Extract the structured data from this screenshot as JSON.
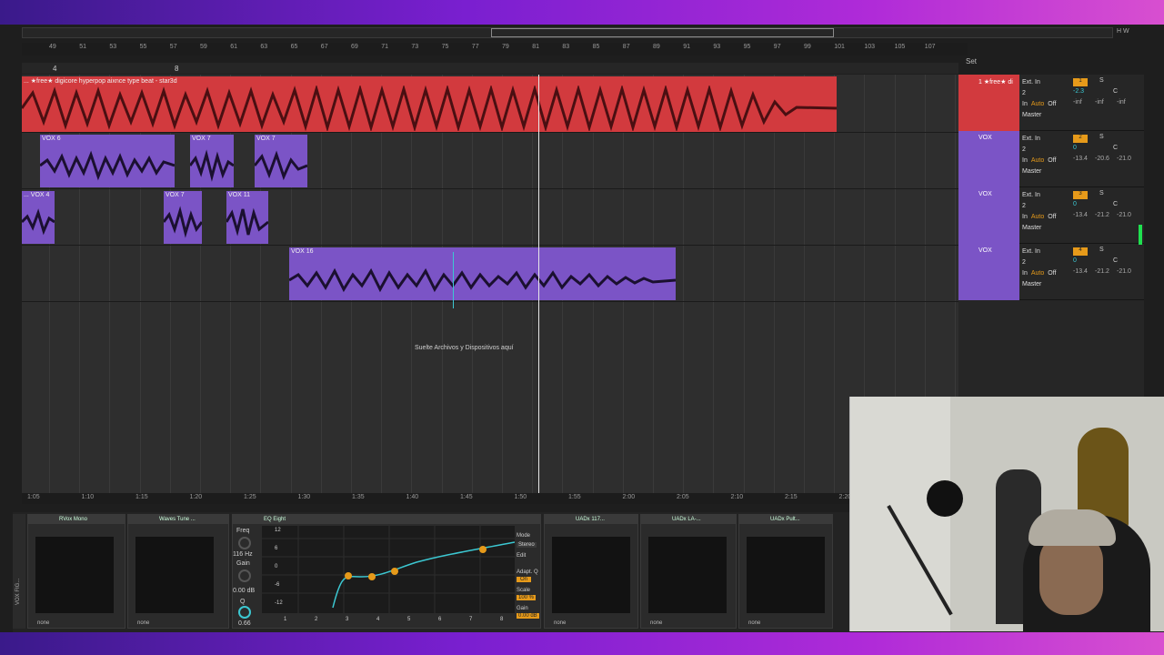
{
  "colors": {
    "audio_track": "#d23a3e",
    "vox_track": "#7b54c6",
    "accent": "#e69a1a",
    "eq_curve": "#3cc8d2"
  },
  "ruler_top": [
    "49",
    "51",
    "53",
    "55",
    "57",
    "59",
    "61",
    "63",
    "65",
    "67",
    "69",
    "71",
    "73",
    "75",
    "77",
    "79",
    "81",
    "83",
    "85",
    "87",
    "89",
    "91",
    "93",
    "95",
    "97",
    "99",
    "101",
    "103",
    "105",
    "107"
  ],
  "ruler_bottom": [
    "1:05",
    "1:10",
    "1:15",
    "1:20",
    "1:25",
    "1:30",
    "1:35",
    "1:40",
    "1:45",
    "1:50",
    "1:55",
    "2:00",
    "2:05",
    "2:10",
    "2:15",
    "2:20"
  ],
  "set_label": "Set",
  "loop_markers": [
    "4",
    "8"
  ],
  "tracks": [
    {
      "clips": [
        {
          "name": "... ★free★ digicore hyperpop aixnce type beat - star3d"
        }
      ]
    },
    {
      "clips": [
        {
          "name": "VOX 6"
        },
        {
          "name": "VOX 7"
        },
        {
          "name": "VOX 7"
        }
      ]
    },
    {
      "clips": [
        {
          "name": "... VOX 4"
        },
        {
          "name": "VOX 7"
        },
        {
          "name": "VOX 11"
        }
      ]
    },
    {
      "clips": [
        {
          "name": "VOX 16"
        }
      ]
    }
  ],
  "drop_text": "Suelte Archivos y Dispositivos aquí",
  "mixer": [
    {
      "name": "1 ★free★ di",
      "input": "Ext. In",
      "channel": "2",
      "monitor_in": "In",
      "monitor_auto": "Auto",
      "monitor_off": "Off",
      "output": "Master",
      "number": "1",
      "vol": "-2.3",
      "pan": "C",
      "peak1": "-inf",
      "peak2": "-inf",
      "peak3": "-inf",
      "solo": "S"
    },
    {
      "name": "VOX",
      "input": "Ext. In",
      "channel": "2",
      "monitor_in": "In",
      "monitor_auto": "Auto",
      "monitor_off": "Off",
      "output": "Master",
      "number": "2",
      "vol": "0",
      "pan": "C",
      "peak1": "-13.4",
      "peak2": "-20.6",
      "peak3": "-21.0",
      "solo": "S"
    },
    {
      "name": "VOX",
      "input": "Ext. In",
      "channel": "2",
      "monitor_in": "In",
      "monitor_auto": "Auto",
      "monitor_off": "Off",
      "output": "Master",
      "number": "3",
      "vol": "0",
      "pan": "C",
      "peak1": "-13.4",
      "peak2": "-21.2",
      "peak3": "-21.0",
      "solo": "S"
    },
    {
      "name": "VOX",
      "input": "Ext. In",
      "channel": "2",
      "monitor_in": "In",
      "monitor_auto": "Auto",
      "monitor_off": "Off",
      "output": "Master",
      "number": "4",
      "vol": "0",
      "pan": "C",
      "peak1": "-13.4",
      "peak2": "-21.2",
      "peak3": "-21.0",
      "solo": "S"
    }
  ],
  "devices": {
    "chain_label": "VOX FIG...",
    "rvox": {
      "title": "RVox Mono",
      "foot": "none"
    },
    "waves_tune": {
      "title": "Waves Tune ...",
      "foot": "none"
    },
    "eq": {
      "title": "EQ Eight",
      "freq_label": "Freq",
      "freq": "116 Hz",
      "gain_label": "Gain",
      "gain": "0.00 dB",
      "q_label": "Q",
      "q": "0.66",
      "mode_label": "Mode",
      "mode": "Stereo",
      "edit": "Edit",
      "adapt": "Adapt. Q",
      "adapt_val": "On",
      "scale_label": "Scale",
      "scale": "100 %",
      "out_label": "Gain",
      "out": "0.00 dB",
      "db_labels": [
        "12",
        "6",
        "0",
        "-6",
        "-12"
      ],
      "bands": [
        "1",
        "2",
        "3",
        "4",
        "5",
        "6",
        "7",
        "8"
      ]
    },
    "uad1": {
      "title": "UADx 117...",
      "foot": "none"
    },
    "uad2": {
      "title": "UADx LA-...",
      "foot": "none"
    },
    "uad3": {
      "title": "UADx Pult...",
      "foot": "none"
    }
  }
}
